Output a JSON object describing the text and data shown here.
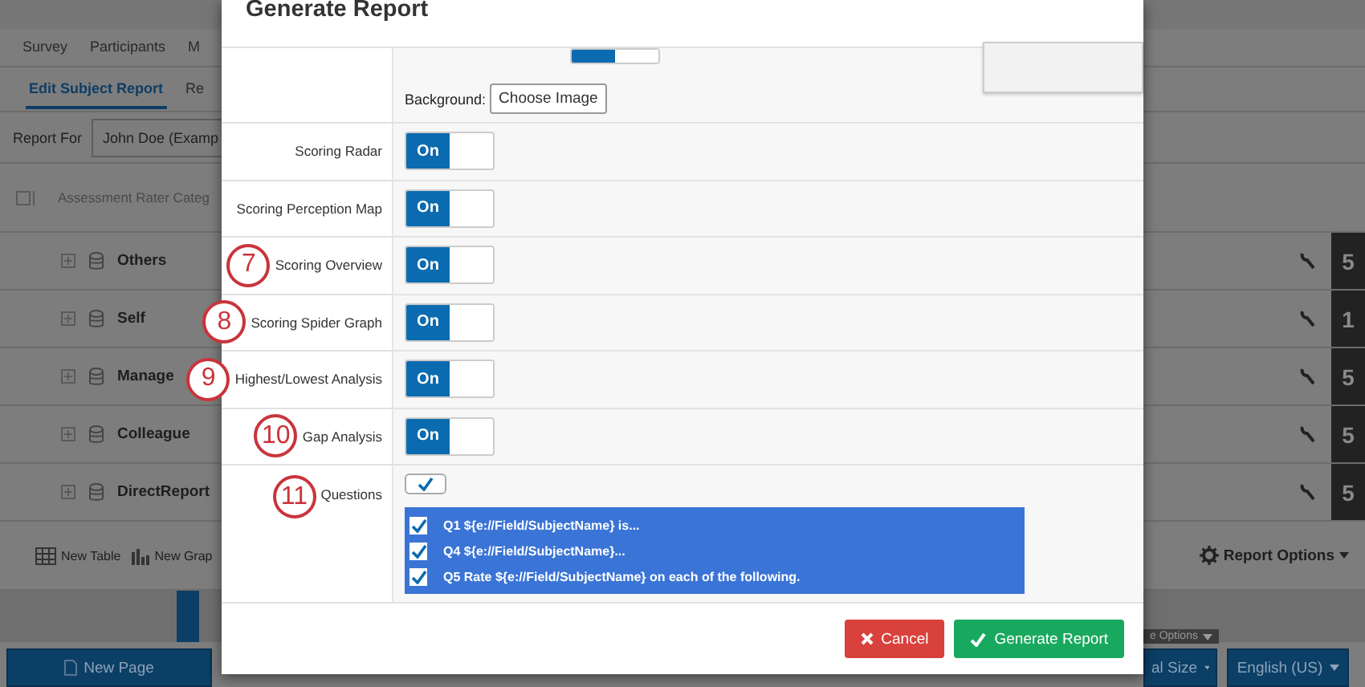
{
  "background": {
    "tabs": [
      {
        "label": "Survey",
        "selected": false
      },
      {
        "label": "Participants",
        "selected": false
      },
      {
        "label": "M",
        "selected": false
      }
    ],
    "subtabs": [
      {
        "label": "Edit Subject Report",
        "selected": true
      },
      {
        "label": "Re",
        "selected": false
      }
    ],
    "report_for": {
      "label": "Report For",
      "value": "John Doe (Examp"
    },
    "category_header": "Assessment Rater Categ",
    "categories": [
      {
        "name": "Others",
        "count": "5"
      },
      {
        "name": "Self",
        "count": "1"
      },
      {
        "name": "Manage",
        "count": "5"
      },
      {
        "name": "Colleague",
        "count": "5"
      },
      {
        "name": "DirectReport",
        "count": "5"
      }
    ],
    "toolbar": [
      "New Table",
      "New Grap"
    ],
    "report_options": "Report Options",
    "footer": {
      "new_page": "New Page",
      "options_hint": "e Options",
      "size": "al Size",
      "language": "English (US)"
    }
  },
  "dialog": {
    "title": "Generate Report",
    "top_toggle": {
      "on": true
    },
    "background": {
      "label": "Background:",
      "button": "Choose Image"
    },
    "rows": [
      {
        "label": "Scoring Radar",
        "on": true,
        "toggle": "On"
      },
      {
        "label": "Scoring Perception Map",
        "on": true,
        "toggle": "On"
      },
      {
        "label": "Scoring Overview",
        "on": true,
        "toggle": "On",
        "marker": "7"
      },
      {
        "label": "Scoring Spider Graph",
        "on": true,
        "toggle": "On",
        "marker": "8"
      },
      {
        "label": "Highest/Lowest Analysis",
        "on": true,
        "toggle": "On",
        "marker": "9"
      },
      {
        "label": "Gap Analysis",
        "on": true,
        "toggle": "On",
        "marker": "10"
      }
    ],
    "questions": {
      "label": "Questions",
      "marker": "11",
      "checked": true,
      "items": [
        {
          "text": "Q1 ${e://Field/SubjectName} is...",
          "checked": true
        },
        {
          "text": "Q4 ${e://Field/SubjectName}...",
          "checked": true
        },
        {
          "text": "Q5 Rate ${e://Field/SubjectName} on each of the following.",
          "checked": true
        }
      ]
    },
    "buttons": {
      "cancel": "Cancel",
      "generate": "Generate Report"
    }
  }
}
